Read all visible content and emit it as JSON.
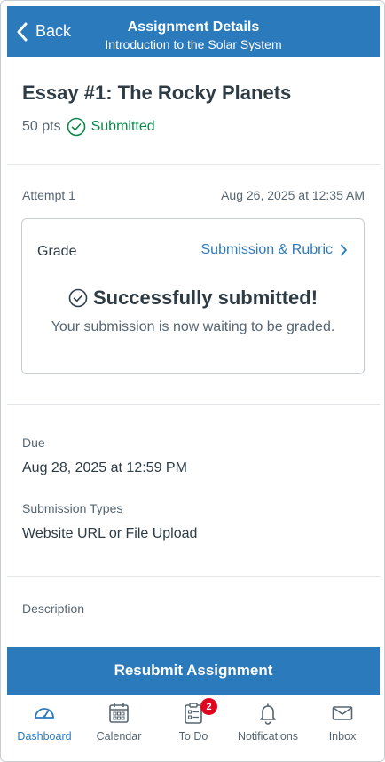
{
  "header": {
    "back_label": "Back",
    "title": "Assignment Details",
    "subtitle": "Introduction to the Solar System"
  },
  "assignment": {
    "title": "Essay #1: The Rocky Planets",
    "points": "50 pts",
    "status": "Submitted"
  },
  "attempt": {
    "label": "Attempt 1",
    "date": "Aug 26, 2025 at 12:35 AM"
  },
  "grade_card": {
    "grade_label": "Grade",
    "rubric_link": "Submission & Rubric",
    "success_title": "Successfully submitted!",
    "waiting_text": "Your submission is now waiting to be graded."
  },
  "due": {
    "label": "Due",
    "value": "Aug 28, 2025 at 12:59 PM"
  },
  "submission_types": {
    "label": "Submission Types",
    "value": "Website URL or File Upload"
  },
  "description": {
    "label": "Description"
  },
  "resubmit_label": "Resubmit Assignment",
  "tabs": [
    {
      "label": "Dashboard",
      "icon": "dashboard-icon",
      "active": true
    },
    {
      "label": "Calendar",
      "icon": "calendar-icon"
    },
    {
      "label": "To Do",
      "icon": "todo-icon",
      "badge": "2"
    },
    {
      "label": "Notifications",
      "icon": "bell-icon"
    },
    {
      "label": "Inbox",
      "icon": "inbox-icon"
    }
  ],
  "colors": {
    "brand": "#2b7abc",
    "success": "#0b874b",
    "badge": "#e0061f"
  }
}
